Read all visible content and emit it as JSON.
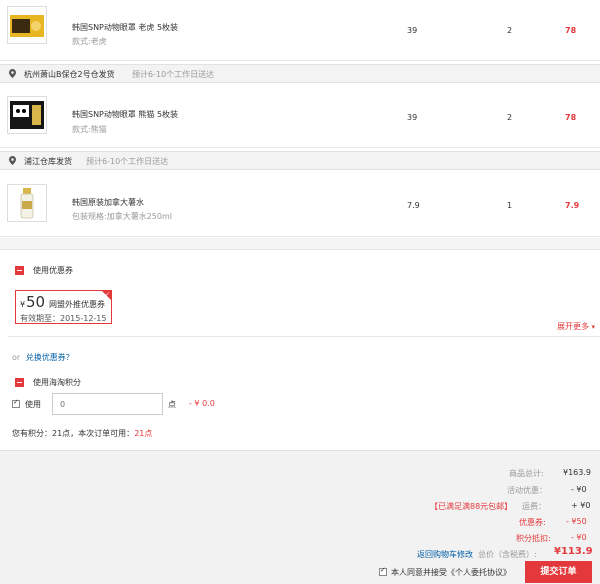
{
  "items": [
    {
      "name": "韩国SNP动物眼罩 老虎 5枚装",
      "spec": "款式:老虎",
      "price": "39",
      "qty": "2",
      "subtotal": "78"
    },
    {
      "name": "韩国SNP动物眼罩 熊猫 5枚装",
      "spec": "款式:熊猫",
      "price": "39",
      "qty": "2",
      "subtotal": "78"
    },
    {
      "name": "韩国原装加拿大薯水",
      "spec": "包装规格:加拿大薯水250ml",
      "price": "7.9",
      "qty": "1",
      "subtotal": "7.9"
    }
  ],
  "warehouses": [
    {
      "name": "杭州萧山B保仓2号仓发货",
      "eta": "预计6-10个工作日送达"
    },
    {
      "name": "浦江仓库发货",
      "eta": "预计6-10个工作日送达"
    }
  ],
  "coupon_section": {
    "title": "使用优惠券",
    "coupon": {
      "currency": "¥",
      "amount": "50",
      "name": "网盟外推优惠券",
      "expiry": "有效期至：2015-12-15"
    },
    "expand": "展开更多",
    "or_text": "or",
    "redeem_link": "兑换优惠券？"
  },
  "points_section": {
    "title": "使用海淘积分",
    "checkbox_label": "使用",
    "input_placeholder": "0",
    "unit": "点",
    "deduction": "- ¥ 0.0",
    "balance_prefix": "您有积分：21点，本次订单可用：",
    "balance_available": "21点"
  },
  "summary": {
    "total_label": "商品总计:",
    "total_value": "¥163.9",
    "promo_label": "活动优惠：",
    "promo_value": "- ¥0",
    "free_shipping_badge": "【已满足满88元包邮】",
    "shipping_label": "运费：",
    "shipping_value": "+ ¥0",
    "coupon_label": "优惠券:",
    "coupon_value": "- ¥50",
    "points_label": "积分抵扣:",
    "points_value": "- ¥0",
    "back_link": "返回购物车修改",
    "grand_label": "总价（含税费）:",
    "grand_value": "¥113.9",
    "agree_text": "本人同意并接受《个人委托协议》",
    "submit_label": "提交订单"
  },
  "colors": {
    "accent": "#e4393c",
    "link": "#005ea7",
    "gray_bg": "#f2f2f2"
  }
}
